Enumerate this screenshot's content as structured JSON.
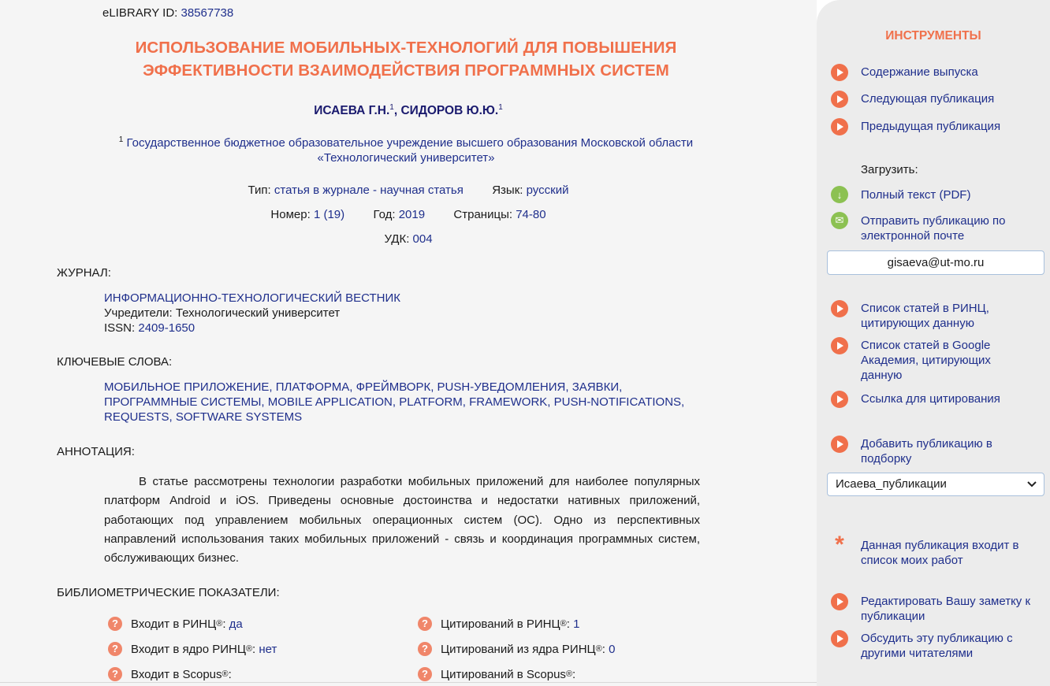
{
  "article": {
    "elibrary_label": "eLIBRARY ID:",
    "elibrary_id": "38567738",
    "title_line1": "ИСПОЛЬЗОВАНИЕ МОБИЛЬНЫХ-ТЕХНОЛОГИЙ ДЛЯ ПОВЫШЕНИЯ",
    "title_line2": "ЭФФЕКТИВНОСТИ ВЗАИМОДЕЙСТВИЯ ПРОГРАММНЫХ СИСТЕМ",
    "authors": [
      {
        "name": "ИСАЕВА Г.Н.",
        "sup": "1"
      },
      {
        "name": "СИДОРОВ Ю.Ю.",
        "sup": "1"
      }
    ],
    "affiliation_sup": "1",
    "affiliation": "Государственное бюджетное образовательное учреждение высшего образования Московской области «Технологический университет»",
    "meta": {
      "type_label": "Тип:",
      "type_value": "статья в журнале - научная статья",
      "lang_label": "Язык:",
      "lang_value": "русский",
      "number_label": "Номер:",
      "number_value": "1 (19)",
      "year_label": "Год:",
      "year_value": "2019",
      "pages_label": "Страницы:",
      "pages_value": "74-80",
      "udk_label": "УДК:",
      "udk_value": "004"
    },
    "journal": {
      "heading": "ЖУРНАЛ:",
      "name": "ИНФОРМАЦИОННО-ТЕХНОЛОГИЧЕСКИЙ ВЕСТНИК",
      "founders": "Учредители: Технологический университет",
      "issn_label": "ISSN:",
      "issn_value": "2409-1650"
    },
    "keywords": {
      "heading": "КЛЮЧЕВЫЕ СЛОВА:",
      "items": [
        "МОБИЛЬНОЕ ПРИЛОЖЕНИЕ",
        "ПЛАТФОРМА",
        "ФРЕЙМВОРК",
        "PUSH-УВЕДОМЛЕНИЯ",
        "ЗАЯВКИ",
        "ПРОГРАММНЫЕ СИСТЕМЫ",
        "MOBILE APPLICATION",
        "PLATFORM",
        "FRAMEWORK",
        "PUSH-NOTIFICATIONS",
        "REQUESTS",
        "SOFTWARE SYSTEMS"
      ]
    },
    "abstract": {
      "heading": "АННОТАЦИЯ:",
      "text": "В статье рассмотрены технологии разработки мобильных приложений для наиболее популярных платформ Android и iOS. Приведены основные достоинства и недостатки нативных приложений, работающих под управлением мобильных операционных систем (ОС). Одно из перспективных направлений использования таких мобильных приложений - связь и координация программных систем, обслуживающих бизнес."
    },
    "biblio": {
      "heading": "БИБЛИОМЕТРИЧЕСКИЕ ПОКАЗАТЕЛИ:",
      "reg": "®",
      "items": [
        {
          "label": "Входит в РИНЦ",
          "value": "да"
        },
        {
          "label": "Цитирований в РИНЦ",
          "value": "1"
        },
        {
          "label": "Входит в ядро РИНЦ",
          "value": "нет"
        },
        {
          "label": "Цитирований из ядра РИНЦ",
          "value": "0"
        },
        {
          "label": "Входит в Scopus",
          "value": ""
        },
        {
          "label": "Цитирований в Scopus",
          "value": ""
        }
      ]
    }
  },
  "sidebar": {
    "title": "ИНСТРУМЕНТЫ",
    "issue_contents": "Содержание выпуска",
    "next_pub": "Следующая публикация",
    "prev_pub": "Предыдущая публикация",
    "download_label": "Загрузить:",
    "full_text": "Полный текст (PDF)",
    "send_email_l1": "Отправить публикацию по",
    "send_email_l2": "электронной почте",
    "email_value": "gisaeva@ut-mo.ru",
    "rinc_cites_l1": "Список статей в РИНЦ,",
    "rinc_cites_l2": "цитирующих данную",
    "google_l1": "Список статей в Google",
    "google_l2": "Академия, цитирующих",
    "google_l3": "данную",
    "cite_link": "Ссылка для цитирования",
    "add_l1": "Добавить публикацию в",
    "add_l2": "подборку",
    "collection_value": "Исаева_публикации",
    "mywork_l1": "Данная публикация входит в",
    "mywork_l2": "список моих работ",
    "note_l1": "Редактировать Вашу заметку к",
    "note_l2": "публикации",
    "discuss_l1": "Обсудить эту публикацию с",
    "discuss_l2": "другими читателями"
  },
  "icons": {
    "play": "play-circle-icon",
    "download": "download-icon",
    "mail": "mail-icon",
    "question": "question-icon",
    "star": "asterisk-icon",
    "chevron": "chevron-down-icon"
  },
  "colors": {
    "accent": "#f0704b",
    "link": "#1f2f8c",
    "green": "#8cc152"
  }
}
